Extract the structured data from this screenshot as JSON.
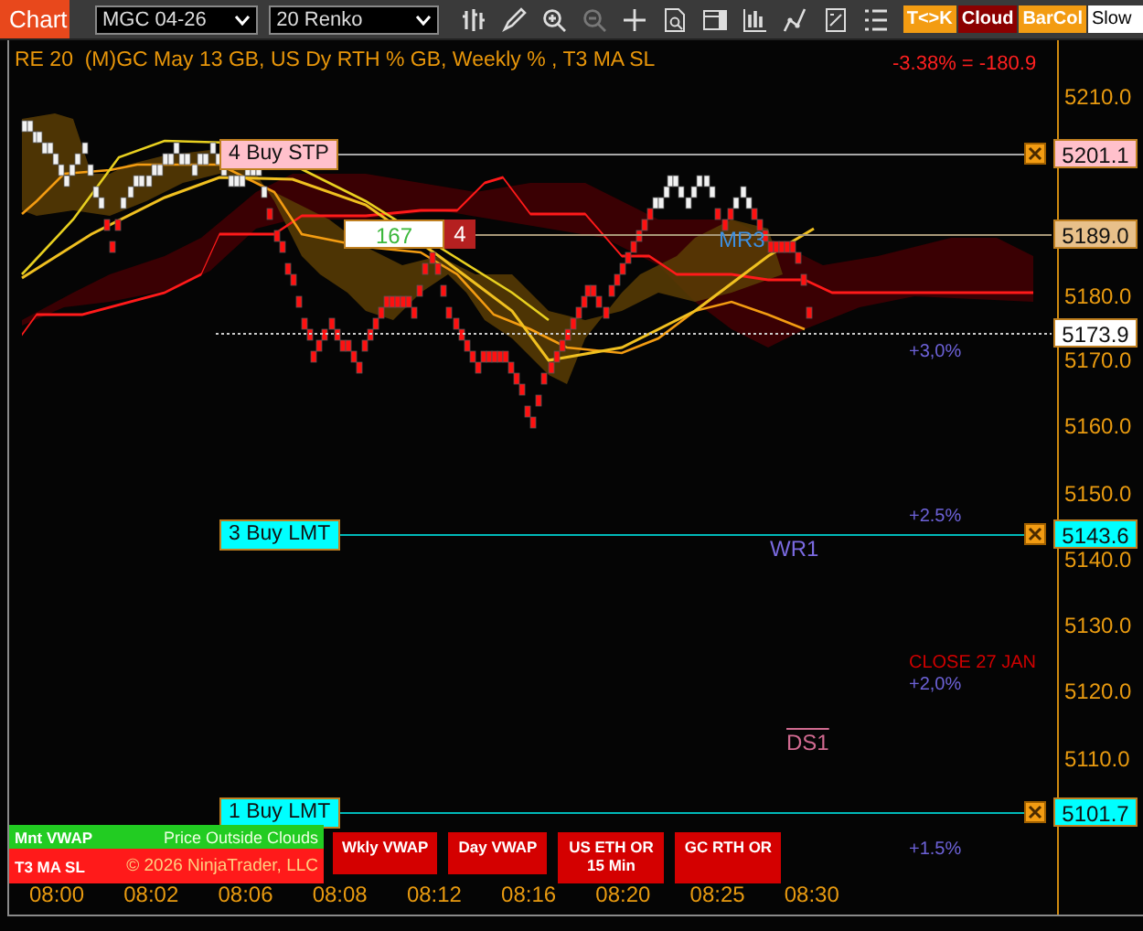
{
  "toolbar": {
    "tab": "Chart",
    "instrument": "MGC 04-26",
    "bar_type": "20 Renko",
    "toggles": [
      {
        "label": "T<>K",
        "color": "#f39c12"
      },
      {
        "label": "Cloud",
        "color": "#8b0000"
      },
      {
        "label": "BarCol",
        "color": "#f39c12"
      },
      {
        "label": "Slow",
        "color": "#ffffff"
      }
    ]
  },
  "chart": {
    "title": "RE 20  (M)GC May 13 GB, US Dy RTH % GB, Weekly % , T3 MA SL",
    "pnl": "-3.38% = -180.9",
    "price_axis": [
      "5210.0",
      "5180.0",
      "5170.0",
      "5160.0",
      "5150.0",
      "5140.0",
      "5130.0",
      "5120.0",
      "5110.0"
    ],
    "orders": [
      {
        "label": "4 Buy STP",
        "price": "5201.1",
        "kind": "stop"
      },
      {
        "label": "3 Buy LMT",
        "price": "5143.6",
        "kind": "limit"
      },
      {
        "label": "1 Buy LMT",
        "price": "5101.7",
        "kind": "limit"
      }
    ],
    "position": {
      "quantity": "167",
      "contracts": "4",
      "price": "5189.0"
    },
    "last_price": "5173.9",
    "annotations": [
      {
        "text": "MR3",
        "kind": "pivot-mid"
      },
      {
        "text": "+3,0%",
        "kind": "percent"
      },
      {
        "text": "+2.5%",
        "kind": "percent"
      },
      {
        "text": "WR1",
        "kind": "pivot-weekly"
      },
      {
        "text": "CLOSE 27 JAN",
        "kind": "close"
      },
      {
        "text": "+2,0%",
        "kind": "percent"
      },
      {
        "text": "DS1",
        "kind": "pivot-daily"
      },
      {
        "text": "+1.5%",
        "kind": "percent"
      }
    ],
    "legend": [
      {
        "label": "Mnt VWAP",
        "note": "Price Outside Clouds",
        "color": "#22cc22"
      },
      {
        "label": "T3 MA SL",
        "note": "© 2026 NinjaTrader, LLC",
        "color": "#ff1a1a"
      }
    ],
    "indicator_boxes": [
      "Wkly VWAP",
      "Day VWAP",
      "US ETH OR 15 Min",
      "GC RTH OR"
    ],
    "time_axis": [
      "08:00",
      "08:02",
      "08:06",
      "08:08",
      "08:12",
      "08:16",
      "08:20",
      "08:25",
      "08:30"
    ]
  }
}
